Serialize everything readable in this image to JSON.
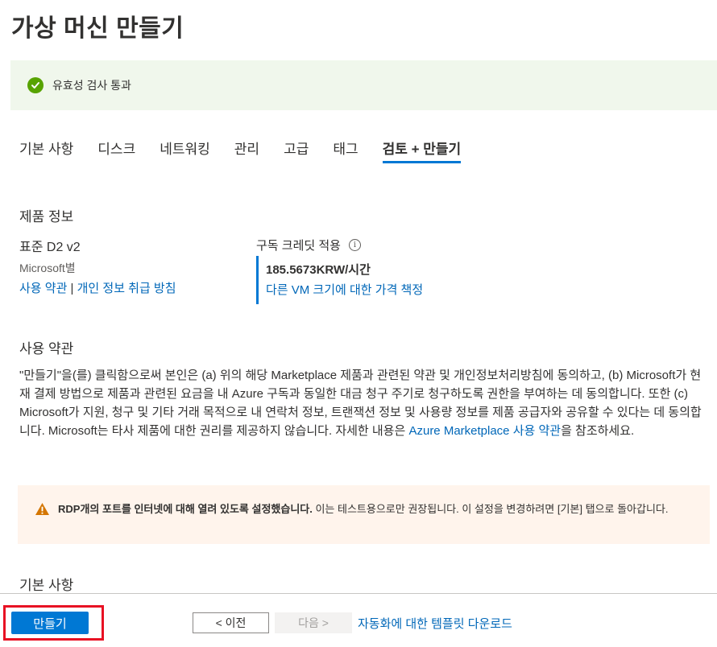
{
  "page": {
    "title": "가상 머신 만들기"
  },
  "validation": {
    "text": "유효성 검사 통과",
    "icon": "check-circle-icon",
    "color": "#57a300"
  },
  "tabs": [
    {
      "label": "기본 사항"
    },
    {
      "label": "디스크"
    },
    {
      "label": "네트워킹"
    },
    {
      "label": "관리"
    },
    {
      "label": "고급"
    },
    {
      "label": "태그"
    },
    {
      "label": "검토 + 만들기",
      "active": true
    }
  ],
  "product": {
    "section_title": "제품 정보",
    "name": "표준 D2 v2",
    "publisher": "Microsoft별",
    "terms_link": "사용 약관",
    "separator": "|",
    "privacy_link": "개인 정보 취급 방침",
    "credit_label": "구독 크레딧 적용",
    "info_icon": "info-icon",
    "price": "185.5673KRW/시간",
    "pricing_link": "다른 VM 크기에 대한 가격 책정"
  },
  "terms": {
    "section_title": "사용 약관",
    "body": "\"만들기\"을(를) 클릭함으로써 본인은 (a) 위의 해당 Marketplace 제품과 관련된 약관 및 개인정보처리방침에 동의하고, (b) Microsoft가 현재 결제 방법으로 제품과 관련된 요금을 내 Azure 구독과 동일한 대금 청구 주기로 청구하도록 권한을 부여하는 데 동의합니다. 또한 (c) Microsoft가 지원, 청구 및 기타 거래 목적으로 내 연락처 정보, 트랜잭션 정보 및 사용량 정보를 제품 공급자와 공유할 수 있다는 데 동의합니다. Microsoft는 타사 제품에 대한 권리를 제공하지 않습니다. 자세한 내용은 ",
    "link": "Azure Marketplace 사용 약관",
    "suffix": "을 참조하세요."
  },
  "warning": {
    "icon": "warning-icon",
    "bold": "RDP개의 포트를 인터넷에 대해 열려 있도록 설정했습니다.",
    "text": " 이는 테스트용으로만 권장됩니다.  이 설정을 변경하려면 [기본] 탭으로 돌아갑니다."
  },
  "basics": {
    "section_title": "기본 사항"
  },
  "footer": {
    "create_label": "만들기",
    "prev_label": "< 이전",
    "next_label": "다음 >",
    "download_link": "자동화에 대한 템플릿 다운로드"
  },
  "colors": {
    "accent": "#0078d4",
    "highlight_outline": "#e81123",
    "warning": "#d47500"
  }
}
